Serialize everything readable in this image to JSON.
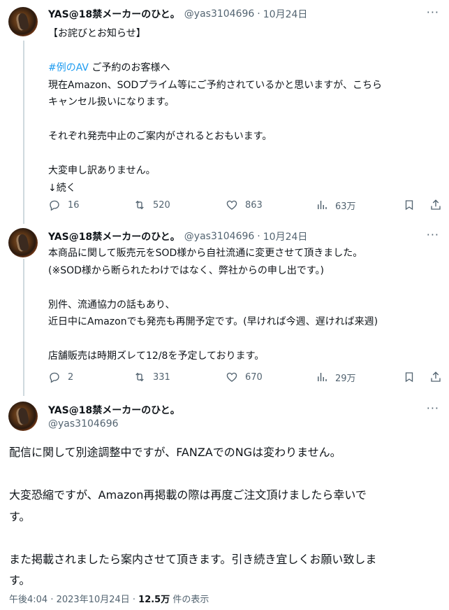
{
  "tweets": [
    {
      "name": "YAS@18禁メーカーのひと。",
      "handle": "@yas3104696",
      "separator": "·",
      "date": "10月24日",
      "more": "···",
      "lines": [
        "【お詫びとお知らせ】",
        "",
        {
          "hashtag": "#例のAV",
          "text": " ご予約のお客様へ"
        },
        "現在Amazon、SODプライム等にご予約されているかと思いますが、こちら",
        "キャンセル扱いになります。",
        "",
        "それぞれ発売中止のご案内がされるとおもいます。",
        "",
        "大変申し訳ありません。",
        "↓続く"
      ],
      "stats": {
        "replies": "16",
        "retweets": "520",
        "likes": "863",
        "views": "63万"
      }
    },
    {
      "name": "YAS@18禁メーカーのひと。",
      "handle": "@yas3104696",
      "separator": "·",
      "date": "10月24日",
      "more": "···",
      "lines": [
        "本商品に関して販売元をSOD様から自社流通に変更させて頂きました。",
        "(※SOD様から断られたわけではなく、弊社からの申し出です。)",
        "",
        "別件、流通協力の話もあり、",
        "近日中にAmazonでも発売も再開予定です。(早ければ今週、遅ければ来週)",
        "",
        "店舗販売は時期ズレて12/8を予定しております。"
      ],
      "stats": {
        "replies": "2",
        "retweets": "331",
        "likes": "670",
        "views": "29万"
      }
    }
  ],
  "main": {
    "name": "YAS@18禁メーカーのひと。",
    "handle": "@yas3104696",
    "more": "···",
    "lines": [
      "配信に関して別途調整中ですが、FANZAでのNGは変わりません。",
      "",
      "大変恐縮ですが、Amazon再掲載の際は再度ご注文頂けましたら幸いで",
      "す。",
      "",
      "また掲載されましたら案内させて頂きます。引き続き宜しくお願い致しま",
      "す。"
    ],
    "time": "午後4:04 · 2023年10月24日 · ",
    "views": "12.5万",
    "views_suffix": " 件の表示"
  },
  "icons": [
    "reply-icon",
    "retweet-icon",
    "like-icon",
    "views-icon",
    "bookmark-icon",
    "share-icon",
    "more-icon"
  ],
  "colors": {
    "text": "#0f1419",
    "secondary": "#536471",
    "hashtag": "#1d9bf0",
    "thread_line": "#cfd9de"
  }
}
